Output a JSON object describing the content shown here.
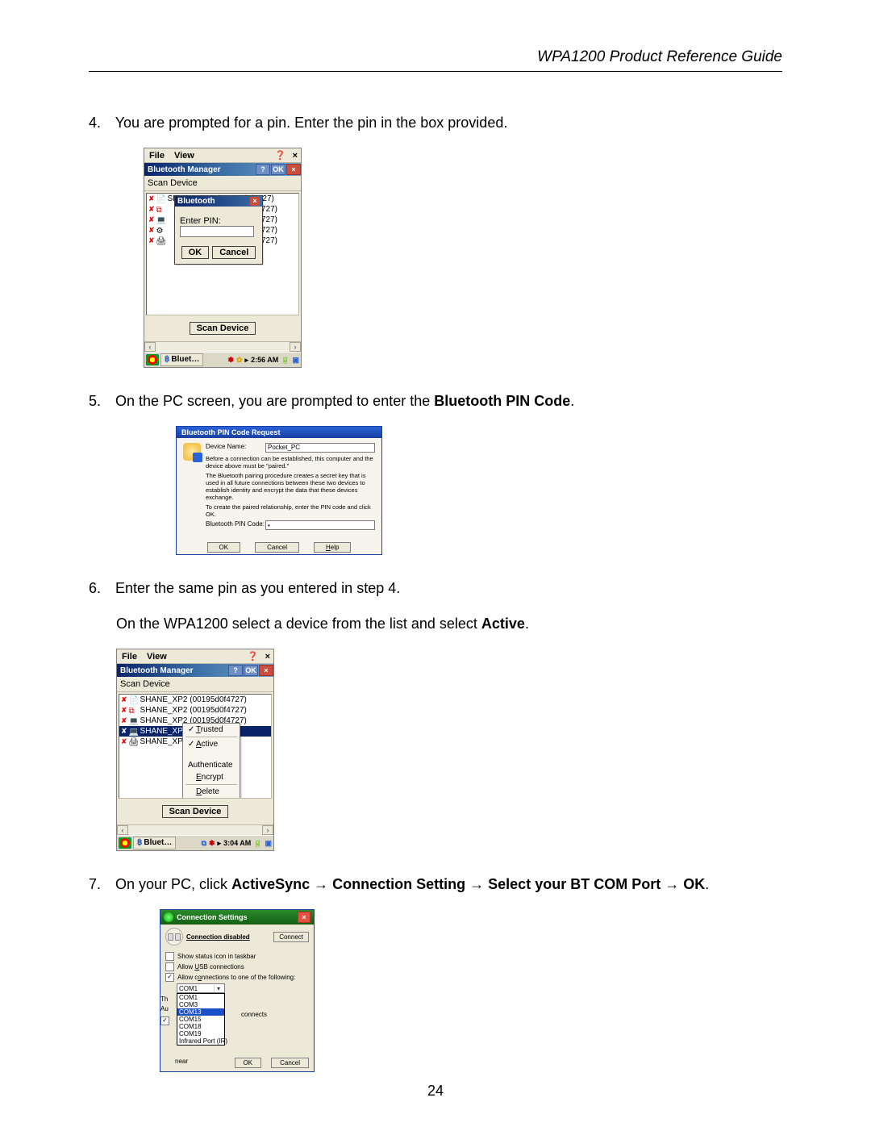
{
  "header": {
    "title": "WPA1200 Product Reference Guide"
  },
  "page_number": "24",
  "steps": {
    "s4": {
      "num": "4.",
      "text": "You are prompted for a pin. Enter the pin in the box provided."
    },
    "s5": {
      "num": "5.",
      "pre": "On the PC screen, you are prompted to enter the ",
      "bold": "Bluetooth PIN Code",
      "post": "."
    },
    "s6": {
      "num": "6.",
      "text": "Enter the same pin as you entered in step 4."
    },
    "s6b": {
      "pre": "On the WPA1200 select a device from the list and select ",
      "bold": "Active",
      "post": "."
    },
    "s7": {
      "num": "7.",
      "pre": "On your PC, click ",
      "p1": "ActiveSync",
      "arrow": " → ",
      "p2": "Connection Setting",
      "p3": "Select your BT COM Port",
      "p4": "OK",
      "post": "."
    }
  },
  "pda": {
    "menu_file": "File",
    "menu_view": "View",
    "help_glyph": "❓",
    "close_glyph": "×",
    "title": "Bluetooth Manager",
    "title_q": "?",
    "title_ok": "OK",
    "toolbar_item": "Scan Device",
    "list_item": "SHANE_XP2 (00195d0f4727)",
    "peek": "727)",
    "pin_popup": {
      "title": "Bluetooth",
      "label": "Enter PIN:",
      "ok": "OK",
      "cancel": "Cancel"
    },
    "scan_btn": "Scan Device",
    "task_btn": "Bluet…",
    "time1": "2:56 AM",
    "time2": "3:04 AM"
  },
  "pc_pin": {
    "title": "Bluetooth PIN Code Request",
    "lbl_device": "Device Name:",
    "device_value": "Pocket_PC",
    "para1": "Before a connection can be established, this computer and the device above must be \"paired.\"",
    "para2": "The Bluetooth pairing procedure creates a secret key that is used in all future connections between these two devices to establish identity and encrypt the data that these devices exchange.",
    "para3": "To create the paired relationship, enter the PIN code and click OK.",
    "lbl_pin": "Bluetooth PIN Code:",
    "pin_value": "•",
    "btn_ok": "OK",
    "btn_cancel": "Cancel",
    "btn_help": "Help"
  },
  "context_menu": {
    "trusted": "Trusted",
    "active": "Active",
    "authenticate": "Authenticate",
    "encrypt": "Encrypt",
    "delete": "Delete"
  },
  "pda3": {
    "row_short": "SHANE_XP",
    "row_sel": "SHANE_XP"
  },
  "cs": {
    "title": "Connection Settings",
    "status": "Connection disabled",
    "connect": "Connect",
    "chk1": "Show status icon in taskbar",
    "chk2_pre": "Allow ",
    "chk2_u": "U",
    "chk2_post": "SB connections",
    "chk3_pre": "Allow c",
    "chk3_u": "o",
    "chk3_post": "nnections to one of the following:",
    "combo_value": "COM1",
    "side1": "Th",
    "side2": "Au",
    "side_word": "connects",
    "side_near": "near",
    "dropdown": [
      "COM1",
      "COM3",
      "COM13",
      "COM15",
      "COM18",
      "COM19",
      "Infrared Port (IR)"
    ],
    "btn_ok": "OK",
    "btn_cancel": "Cancel"
  }
}
